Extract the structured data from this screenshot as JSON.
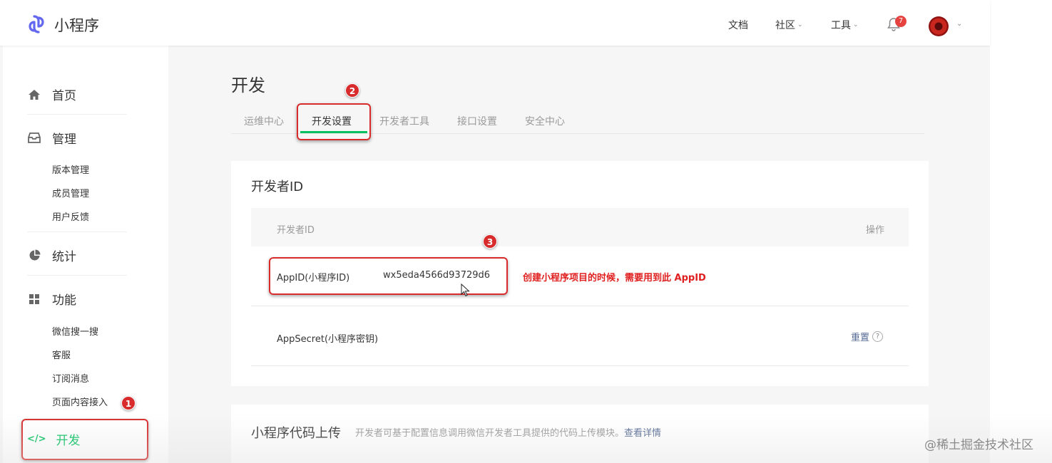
{
  "brand": {
    "name": "小程序",
    "accent": "#07c160",
    "logo_color": "#6467f0"
  },
  "topnav": {
    "docs": "文档",
    "community": "社区",
    "tools": "工具",
    "notification_count": "7"
  },
  "sidebar": {
    "home": "首页",
    "manage": "管理",
    "manage_items": [
      "版本管理",
      "成员管理",
      "用户反馈"
    ],
    "stats": "统计",
    "features": "功能",
    "feature_items": [
      "微信搜一搜",
      "客服",
      "订阅消息",
      "页面内容接入"
    ],
    "develop": "开发"
  },
  "main": {
    "title": "开发",
    "tabs": [
      "运维中心",
      "开发设置",
      "开发者工具",
      "接口设置",
      "安全中心"
    ],
    "active_tab": "开发设置"
  },
  "developer_id": {
    "title": "开发者ID",
    "col_id": "开发者ID",
    "col_op": "操作",
    "appid_label": "AppID(小程序ID)",
    "appid_value": "wx5eda4566d93729d6",
    "secret_label": "AppSecret(小程序密钥)",
    "reset": "重置",
    "help": "?"
  },
  "annotations": {
    "note": "创建小程序项目的时候，需要用到此 AppID",
    "step1": "1",
    "step2": "2",
    "step3": "3",
    "color": "#d82b2b"
  },
  "upload": {
    "title": "小程序代码上传",
    "desc": "开发者可基于配置信息调用微信开发者工具提供的代码上传模块。",
    "link": "查看详情"
  },
  "watermark": "@稀土掘金技术社区"
}
